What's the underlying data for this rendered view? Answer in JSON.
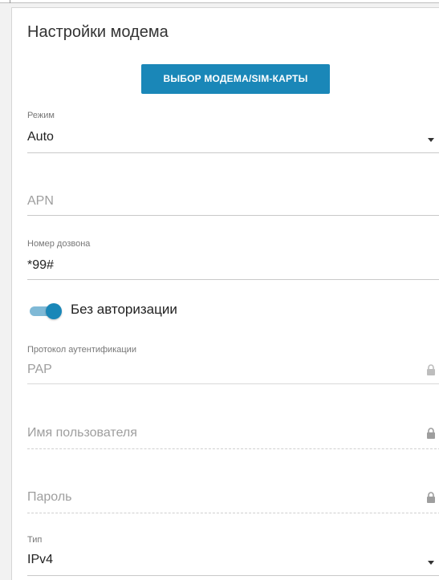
{
  "panel": {
    "title": "Настройки модема"
  },
  "select_button": {
    "label": "ВЫБОР МОДЕМА/SIM-КАРТЫ"
  },
  "mode": {
    "label": "Режим",
    "value": "Auto"
  },
  "apn": {
    "placeholder": "APN"
  },
  "dial_number": {
    "label": "Номер дозвона",
    "value": "*99#"
  },
  "no_auth": {
    "label": "Без авторизации",
    "enabled": true
  },
  "auth_protocol": {
    "label": "Протокол аутентификации",
    "value": "PAP",
    "locked": true
  },
  "username": {
    "placeholder": "Имя пользователя",
    "locked": true
  },
  "password": {
    "placeholder": "Пароль",
    "locked": true
  },
  "type": {
    "label": "Тип",
    "value": "IPv4"
  },
  "icons": {
    "dropdown": "chevron-down-icon",
    "lock": "lock-icon"
  },
  "colors": {
    "accent": "#1a87b8",
    "toggle_track": "#7fb9d6"
  }
}
